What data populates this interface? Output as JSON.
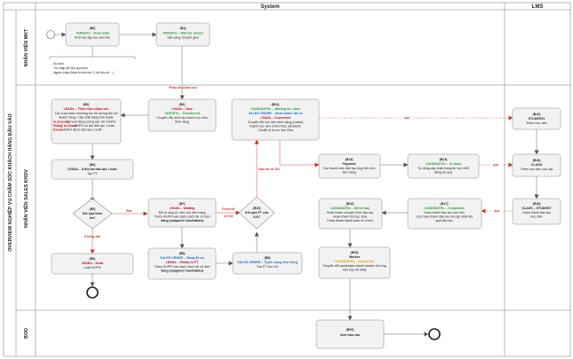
{
  "diagram": {
    "title": "OVERVIEW NGHIỆP VỤ CHĂM SÓC KHÁCH HÀNG ĐẦU VÀO",
    "columns": [
      "System",
      "LMS"
    ],
    "lanes": [
      "NHÂN VIÊN MKT",
      "NHÂN VIÊN SALES KHDV",
      "BOD"
    ],
    "nodes": {
      "b0": {
        "id": "(B0)",
        "title": "TARGETs – Draw data",
        "line1": "Khởi tạo tập học viên thô"
      },
      "b1": {
        "id": "(B1)",
        "title": "TARGETs – Wait for deliver",
        "line1": "Sẵn sàng chuyển giao"
      },
      "note": {
        "line1": "- Sự kiện",
        "line2": "- Thu thập dữ liệu qua form",
        "line3": "- Nguồn khác (Mua từ bên thứ 3, dữ liệu cũ ...)"
      },
      "b3": {
        "id": "(B3)",
        "title": "LEADs – Thực hiện chăm sóc",
        "line1": "Tạo cuộc task/ meeting tou trỏ tương tác với",
        "line2": "khách hàng. Cập nhật trạng thái leads",
        "in_process_label": "In process:",
        "in_process": "Có hoạt động tương tác với HV/PH",
        "ready_label": "Ready to Demo:",
        "ready": "HV/PH có lịch đến tạo 1 tuần",
        "demo_label": "Demo:",
        "demo": "HV/PH được đến tạo 1 buổi"
      },
      "b2": {
        "id": "(B2)",
        "title": "LEADs – New",
        "title2": "TARGETs – Transferred",
        "line1": "Chuyển đổi, khởi tạo thành học viên",
        "line2": "tiềm năng"
      },
      "b11": {
        "id": "(B11)",
        "title": "CANDIDATEs – Waiting for class",
        "title2": "SALES ORDER – Hoàn thành đã cử",
        "title3": "LEADs – Converted",
        "line1": "Chuyển đổi học viên tiềm năng (Leads)",
        "line2": "thành học viên chính thức (Student)",
        "line3": "Chuẩn bị hồ sơ làm Visa"
      },
      "b12": {
        "id": "(B12)",
        "title": "STUDENTs",
        "line1": "Thêm học viên"
      },
      "b4": {
        "id": "(B4)",
        "title": "LEADs – Kiểm tra đào tạo 1 tuần",
        "line1": "Tạo PT"
      },
      "b13": {
        "id": "(B13)",
        "title": "Payment",
        "line1": "Tạo thanh toán đào tạo ứng viên cho",
        "line2": "đơn hàng"
      },
      "b14": {
        "id": "(B14)",
        "title": "CANDIDATEs – In class",
        "line1": "Tự động cập nhật thông tin lớp LMS",
        "line2": "đồng bộ qua"
      },
      "b15": {
        "id": "(B15)",
        "title": "CLASS",
        "line1": "Thêm học viên vào lớp"
      },
      "b5": {
        "id": "(B5)",
        "line1": "Kết quả kiểm",
        "line2": "tra?"
      },
      "b7": {
        "id": "(B7)",
        "title": "LEADs – Waiting",
        "line1": "Đã có ứng cử viên cho đơn hàng",
        "line2": "Thêm HV/PH vào danh sách đề cử đơn",
        "line3": "hàng (subpanel Candidates)"
      },
      "b10": {
        "id": "(B10)",
        "line1": "Kết quả PT của",
        "line2": "SOT"
      },
      "b16": {
        "id": "(B16)",
        "title": "CANDIDATEs – Đã thi bay",
        "line1": "Hoàn thành chuyến trình đào tạo",
        "line2": "Hoàn thành thủ tục Visa",
        "line3": "Hoàn thành thanh toán hồ chính"
      },
      "b17": {
        "id": "(B17)",
        "title": "CANDIDATEs – Completed",
        "line1": "Hoàn thành đào tạo học viên",
        "line2": "Lớp hoàn thành đào tạo và cập nhật kết",
        "line3": "quả đào tạo"
      },
      "b18": {
        "id": "(B18)",
        "title": "CLASS – STUDENT",
        "line1": "Hoàn thành đào tạo",
        "line2": "học viên"
      },
      "b6": {
        "id": "(B6)",
        "title": "LEADs – Dead",
        "line1": "Loại HV/PH"
      },
      "b8": {
        "id": "(B8)",
        "title": "SALES ORDER – Đang đề cử",
        "title2": "LEADs – Ready to PT",
        "line1": "Thêm HV/PH vào danh sách đề cử đơn",
        "line2": "hàng (subpanel Candidates)"
      },
      "b9": {
        "id": "(B9)",
        "title": "SALES ORDER – Tuyển dụng đơn hàng",
        "line1": "Tạo PT cho SO"
      },
      "b19": {
        "id": "(B19)",
        "title": "Worker",
        "title2": "CANDIDATEs – Converted",
        "line1": "Chuyển đổi candidates thành worker khi ứng",
        "line2": "viên bay tới Nhật"
      },
      "b20": {
        "id": "(B20)",
        "line1": "Xem báo cáo"
      }
    },
    "edge_labels": {
      "phan_bo": "Phân bổ chăm sóc",
      "dat": "Đạt",
      "khong_dat": "Không đạt",
      "truot": "Trượt đề",
      "cu_so": "cử SO",
      "dau": "Đậu đề cử SO",
      "api": "API"
    }
  }
}
